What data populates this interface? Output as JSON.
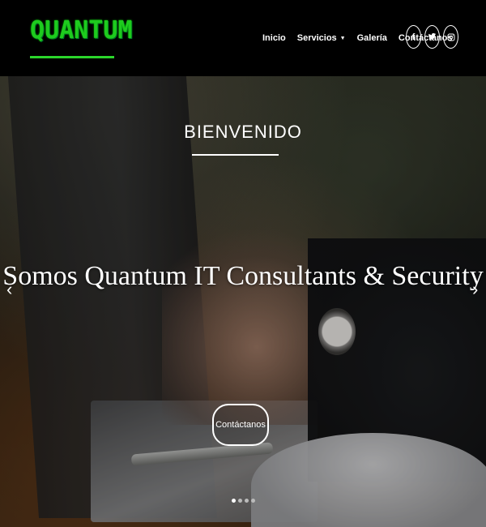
{
  "brand": {
    "logo_text": "QUANTUM",
    "accent_color": "#1ecb1e"
  },
  "nav": {
    "items": [
      {
        "label": "Inicio"
      },
      {
        "label": "Servicios",
        "has_dropdown": true
      },
      {
        "label": "Galería"
      },
      {
        "label": "Contáctanos"
      }
    ]
  },
  "socials": [
    {
      "icon": "facebook-icon",
      "glyph": "f"
    },
    {
      "icon": "twitter-icon",
      "glyph": "t"
    },
    {
      "icon": "instagram-icon",
      "glyph": "ig"
    }
  ],
  "hero": {
    "welcome": "BIENVENIDO",
    "headline": "Somos Quantum IT Consultants & Security",
    "cta_label": "Contáctanos",
    "slides_count": 4,
    "active_slide": 1
  }
}
